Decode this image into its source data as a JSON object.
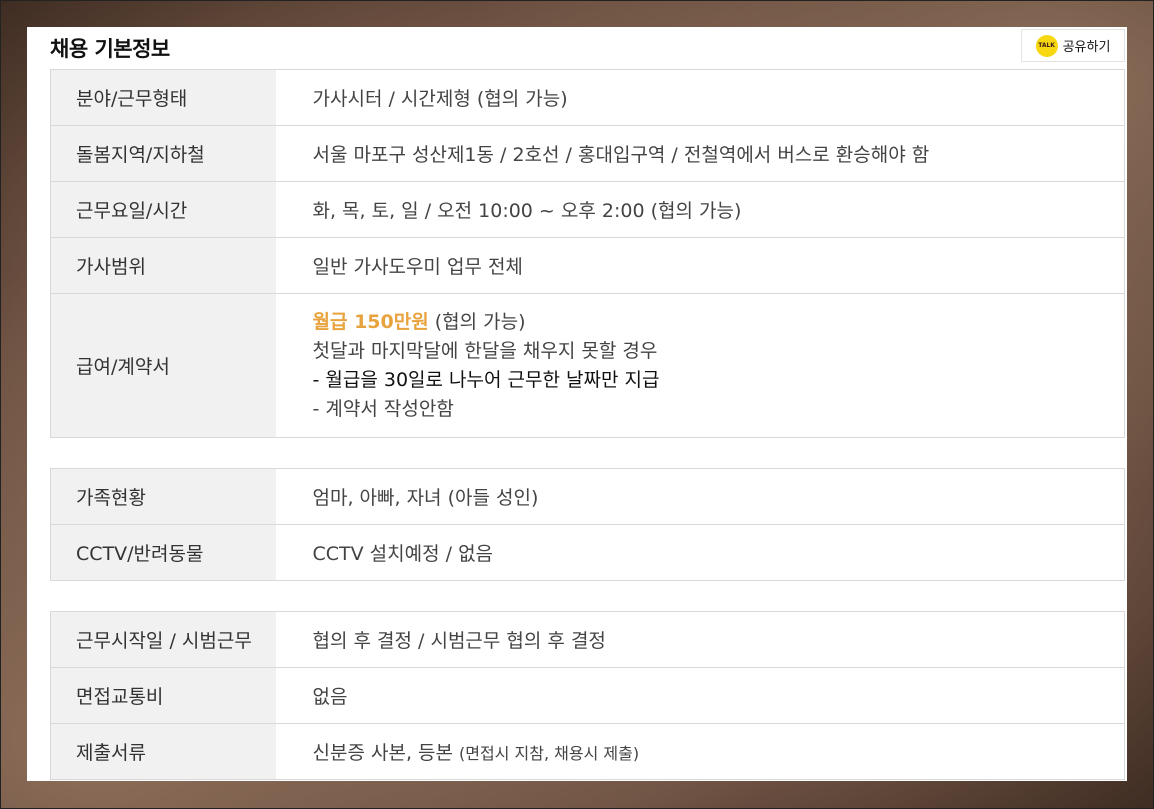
{
  "header": {
    "title": "채용 기본정보",
    "share_label": "공유하기",
    "share_icon_text": "TALK",
    "share_icon": "kakaotalk-icon"
  },
  "section1": {
    "rows": [
      {
        "label": "분야/근무형태",
        "value": "가사시터 / 시간제형 (협의 가능)"
      },
      {
        "label": "돌봄지역/지하철",
        "value": "서울 마포구 성산제1동 / 2호선 / 홍대입구역 / 전철역에서 버스로 환승해야 함"
      },
      {
        "label": "근무요일/시간",
        "value": "화, 목, 토, 일 / 오전 10:00 ~ 오후 2:00 (협의 가능)"
      },
      {
        "label": "가사범위",
        "value": "일반 가사도우미 업무 전체"
      }
    ],
    "salary": {
      "label": "급여/계약서",
      "amount": "월급 150만원",
      "negotiable": "(협의 가능)",
      "line2": "첫달과 마지막달에 한달을 채우지 못할 경우",
      "line3": "- 월급을 30일로 나누어 근무한 날짜만 지급",
      "line4": "- 계약서 작성안함"
    }
  },
  "section2": {
    "rows": [
      {
        "label": "가족현황",
        "value": "엄마, 아빠, 자녀 (아들 성인)"
      },
      {
        "label": "CCTV/반려동물",
        "value": "CCTV 설치예정 / 없음"
      }
    ]
  },
  "section3": {
    "rows": [
      {
        "label": "근무시작일 / 시범근무",
        "value": "협의 후 결정 / 시범근무 협의 후 결정"
      },
      {
        "label": "면접교통비",
        "value": "없음"
      }
    ],
    "documents": {
      "label": "제출서류",
      "value": "신분증 사본, 등본",
      "note": "(면접시 지참, 채용시 제출)"
    }
  },
  "colors": {
    "accent_salary": "#e8a33f",
    "kakao_yellow": "#f7d70f",
    "header_cell_bg": "#f1f1f1",
    "border": "#d9d9d9"
  }
}
